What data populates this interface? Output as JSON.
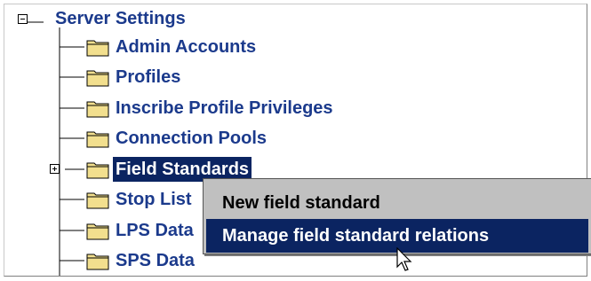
{
  "tree": {
    "root": {
      "label": "Server Settings",
      "expander_icon": "minus-box-icon"
    },
    "items": [
      {
        "label": "Admin Accounts",
        "icon": "folder-icon"
      },
      {
        "label": "Profiles",
        "icon": "folder-icon"
      },
      {
        "label": "Inscribe Profile Privileges",
        "icon": "folder-icon"
      },
      {
        "label": "Connection Pools",
        "icon": "folder-icon"
      },
      {
        "label": "Field Standards",
        "icon": "folder-icon",
        "selected": true,
        "expander_icon": "plus-box-icon"
      },
      {
        "label": "Stop List",
        "icon": "folder-icon"
      },
      {
        "label": "LPS Data",
        "icon": "folder-icon"
      },
      {
        "label": "SPS Data",
        "icon": "folder-icon"
      }
    ]
  },
  "context_menu": {
    "items": [
      {
        "label": "New field standard"
      },
      {
        "label": "Manage field standard relations",
        "highlighted": true
      }
    ]
  },
  "colors": {
    "label_text": "#1b3a8c",
    "selection_bg": "#0b2461",
    "menu_bg": "#c0c0c0",
    "folder_fill": "#f2df8e"
  }
}
